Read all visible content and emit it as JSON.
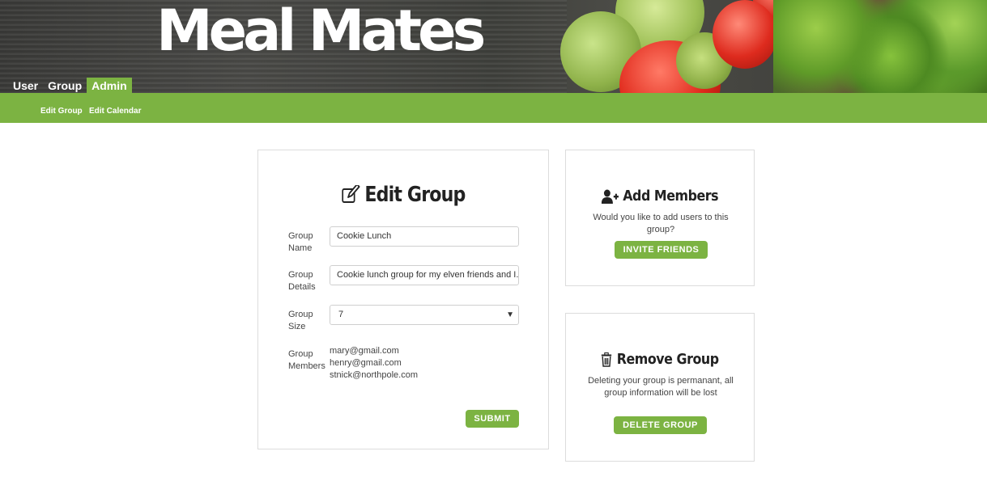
{
  "app": {
    "title": "Meal Mates"
  },
  "nav": {
    "main": [
      {
        "label": "User",
        "active": false
      },
      {
        "label": "Group",
        "active": false
      },
      {
        "label": "Admin",
        "active": true
      }
    ],
    "sub": [
      {
        "label": "Edit Group"
      },
      {
        "label": "Edit Calendar"
      }
    ]
  },
  "edit_group": {
    "heading": "Edit Group",
    "icon": "edit-icon",
    "fields": {
      "name_label_1": "Group",
      "name_label_2": "Name",
      "name_value": "Cookie Lunch",
      "details_label_1": "Group",
      "details_label_2": "Details",
      "details_value": "Cookie lunch group for my elven friends and I.",
      "size_label_1": "Group",
      "size_label_2": "Size",
      "size_value": "7",
      "members_label_1": "Group",
      "members_label_2": "Members"
    },
    "members": [
      "mary@gmail.com",
      "henry@gmail.com",
      "stnick@northpole.com"
    ],
    "submit_label": "SUBMIT"
  },
  "add_members": {
    "heading": "Add Members",
    "icon": "user-plus-icon",
    "text_line1": "Would you like to add users to this",
    "text_line2": "group?",
    "button_label": "INVITE FRIENDS"
  },
  "remove_group": {
    "heading": "Remove Group",
    "icon": "trash-icon",
    "text_line1": "Deleting your group is permanant, all",
    "text_line2": "group information will be lost",
    "button_label": "DELETE GROUP"
  },
  "colors": {
    "accent": "#7cb342",
    "border": "#dcdcdc",
    "heading": "#222222"
  }
}
